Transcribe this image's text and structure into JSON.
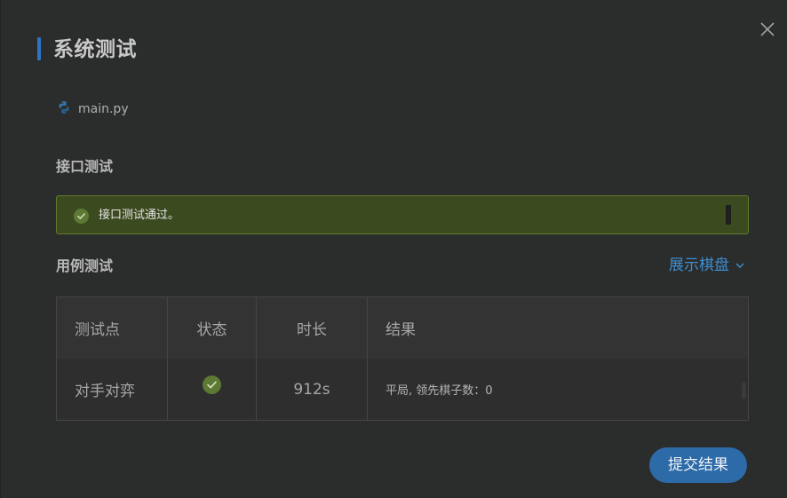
{
  "dialog": {
    "title": "系统测试",
    "file": {
      "name": "main.py",
      "icon": "python-icon"
    }
  },
  "interface_test": {
    "title": "接口测试",
    "message": "接口测试通过。",
    "icon": "check-circle-icon",
    "status_color": "#5f7a2c"
  },
  "case_test": {
    "title": "用例测试",
    "toggle_label": "展示棋盘",
    "toggle_icon": "chevron-down-icon",
    "columns": [
      "测试点",
      "状态",
      "时长",
      "结果"
    ],
    "rows": [
      {
        "point": "对手对弈",
        "status_icon": "check-circle-icon",
        "duration": "912s",
        "result": "平局, 领先棋子数：0"
      }
    ]
  },
  "actions": {
    "submit_label": "提交结果"
  },
  "colors": {
    "accent": "#2f74c0",
    "link": "#3c8fd3",
    "success_bg": "#3c4a20",
    "button": "#2d6aa8"
  }
}
